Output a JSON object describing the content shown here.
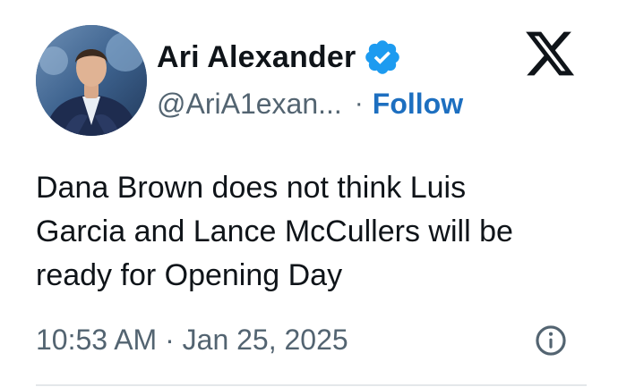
{
  "author": {
    "display_name": "Ari Alexander",
    "handle": "@AriA1exan...",
    "verified": true,
    "avatar_icon": "profile-photo"
  },
  "follow_label": "Follow",
  "separator": "·",
  "tweet": {
    "text": "Dana Brown does not think Luis\nGarcia and Lance McCullers will be\nready for Opening Day"
  },
  "meta": {
    "timestamp": "10:53 AM · Jan 25, 2025"
  },
  "colors": {
    "text": "#0f1419",
    "muted": "#536471",
    "link": "#1d6fc0",
    "verified_badge": "#1d9bf0"
  },
  "icons": {
    "verified": "verified-badge-icon",
    "brand": "x-logo-icon",
    "info": "info-icon"
  }
}
